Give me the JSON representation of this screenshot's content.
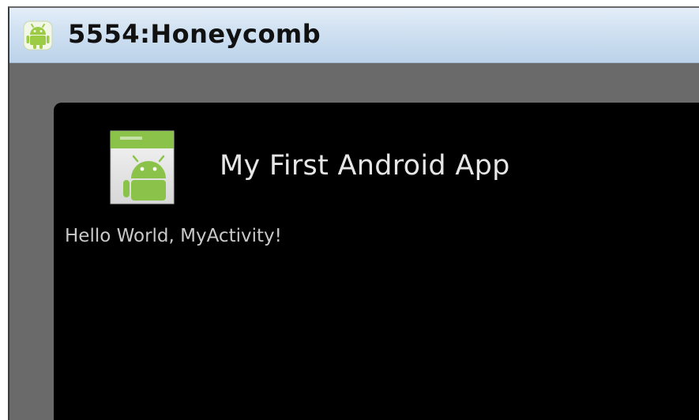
{
  "window": {
    "title": "5554:Honeycomb",
    "icon": "android-robot-icon"
  },
  "app": {
    "launcher_icon": "android-app-launcher-icon",
    "title": "My First Android App",
    "hello_text": "Hello World, MyActivity!"
  },
  "colors": {
    "titlebar": "#cfe0f1",
    "frame": "#6b6b6b",
    "screen": "#000000",
    "android_green": "#8bc34a"
  }
}
